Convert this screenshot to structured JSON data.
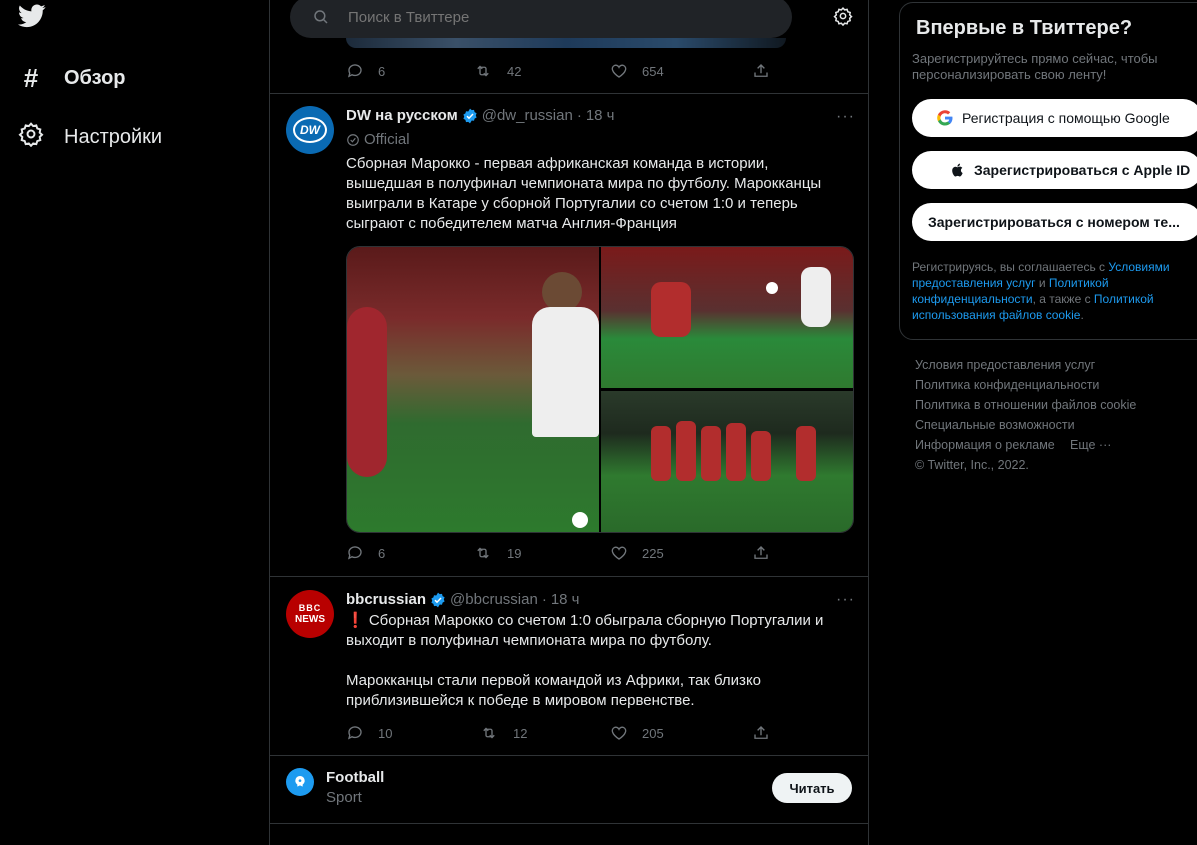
{
  "nav": {
    "items": [
      {
        "label": "Обзор",
        "icon": "hashtag-icon"
      },
      {
        "label": "Настройки",
        "icon": "gear-icon"
      }
    ]
  },
  "search": {
    "placeholder": "Поиск в Твиттере"
  },
  "top_tweet_actions": {
    "replies": "6",
    "retweets": "42",
    "likes": "654"
  },
  "tweets": [
    {
      "name": "DW на русском",
      "handle": "@dw_russian",
      "time": "18 ч",
      "official": "Official",
      "avatar_text": "DW",
      "text": "Сборная Марокко - первая африканская команда в истории, вышедшая в полуфинал чемпионата мира по футболу. Марокканцы выиграли в Катаре у сборной Португалии со счетом 1:0 и теперь сыграют с победителем матча Англия-Франция",
      "replies": "6",
      "retweets": "19",
      "likes": "225"
    },
    {
      "name": "bbcrussian",
      "handle": "@bbcrussian",
      "time": "18 ч",
      "avatar_text_1": "BBC",
      "avatar_text_2": "NEWS",
      "text_1": "❗ Сборная Марокко со счетом 1:0 обыграла сборную Португалии и выходит в полуфинал чемпионата мира по футболу.",
      "text_2": "Марокканцы стали первой командой из Африки, так близко приблизившейся к победе в мировом первенстве.",
      "replies": "10",
      "retweets": "12",
      "likes": "205"
    }
  ],
  "topic": {
    "title": "Football",
    "subtitle": "Sport",
    "button": "Читать"
  },
  "signup": {
    "title": "Впервые в Твиттере?",
    "subtitle": "Зарегистрируйтесь прямо сейчас, чтобы персонализировать свою ленту!",
    "google": "Регистрация с помощью Google",
    "apple": "Зарегистрироваться с Apple ID",
    "phone": "Зарегистрироваться с номером те...",
    "terms_1": "Регистрируясь, вы соглашаетесь с ",
    "terms_link_1": "Условиями предоставления услуг",
    "terms_2": " и ",
    "terms_link_2": "Политикой конфиденциальности",
    "terms_3": ", а также с ",
    "terms_link_3": "Политикой использования файлов cookie",
    "terms_4": "."
  },
  "footer": {
    "links": [
      "Условия предоставления услуг",
      "Политика конфиденциальности",
      "Политика в отношении файлов cookie",
      "Специальные возможности",
      "Информация о рекламе"
    ],
    "more": "Еще ···",
    "copyright": "© Twitter, Inc., 2022."
  },
  "colors": {
    "background": "#000000",
    "accent": "#1d9bf0",
    "muted": "#71767b",
    "border": "#2f3336"
  }
}
